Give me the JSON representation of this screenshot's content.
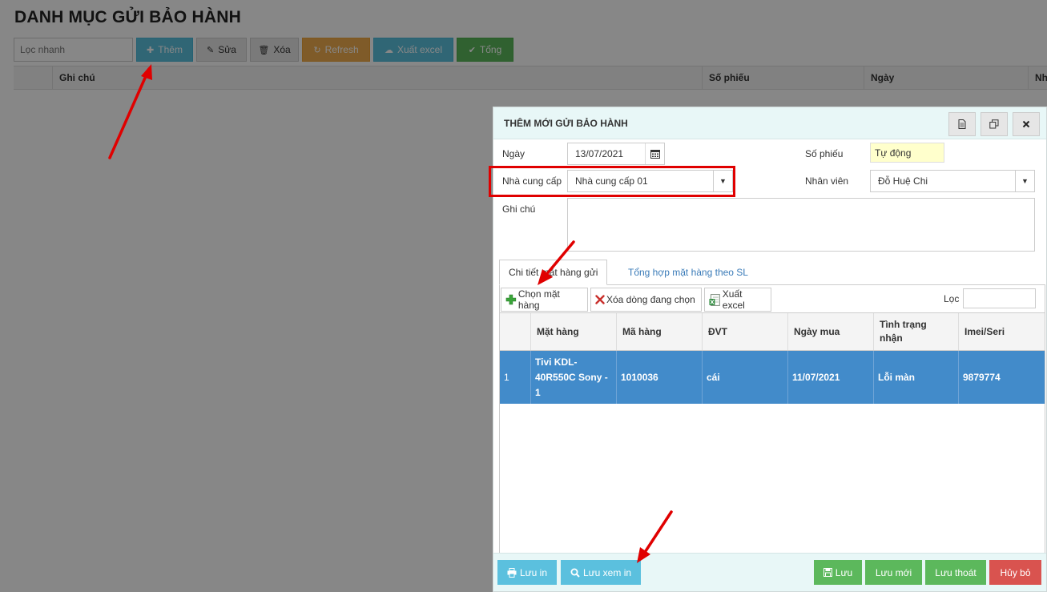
{
  "page": {
    "title": "DANH MỤC GỬI BẢO HÀNH",
    "quick_filter_placeholder": "Lọc nhanh",
    "toolbar": {
      "add": "Thêm",
      "edit": "Sửa",
      "delete": "Xóa",
      "refresh": "Refresh",
      "export": "Xuất excel",
      "total": "Tổng"
    },
    "grid_columns": [
      "",
      "Ghi chú",
      "Số phiếu",
      "Ngày",
      "Nh"
    ]
  },
  "modal": {
    "title": "THÊM MỚI GỬI BẢO HÀNH",
    "form": {
      "date_label": "Ngày",
      "date_value": "13/07/2021",
      "voucher_label": "Số phiếu",
      "voucher_value": "Tự động",
      "supplier_label": "Nhà cung cấp",
      "supplier_value": "Nhà cung cấp 01",
      "staff_label": "Nhân viên",
      "staff_value": "Đỗ Huệ Chi",
      "note_label": "Ghi chú",
      "note_value": ""
    },
    "tabs": [
      "Chi tiết mặt hàng gửi",
      "Tổng hợp mặt hàng theo SL"
    ],
    "subtoolbar": {
      "choose": "Chọn mặt hàng",
      "delete_row": "Xóa dòng đang chọn",
      "export": "Xuất excel",
      "filter_label": "Lọc"
    },
    "detail_columns": [
      "",
      "Mặt hàng",
      "Mã hàng",
      "ĐVT",
      "Ngày mua",
      "Tình trạng nhận",
      "Imei/Seri"
    ],
    "rows": [
      {
        "no": "1",
        "item": "Tivi KDL-40R550C Sony - 1",
        "code": "1010036",
        "unit": "cái",
        "purchase_date": "11/07/2021",
        "status": "Lỗi màn",
        "imei": "9879774"
      }
    ],
    "footer": {
      "save_print": "Lưu in",
      "save_preview": "Lưu xem in",
      "save": "Lưu",
      "save_new": "Lưu mới",
      "save_exit": "Lưu thoát",
      "cancel": "Hủy bỏ"
    }
  },
  "colors": {
    "info": "#5bc0de",
    "warning": "#f0ad4e",
    "success": "#5cb85c",
    "danger": "#d9534f",
    "selected_row": "#428bca",
    "annotation": "#e00000"
  }
}
